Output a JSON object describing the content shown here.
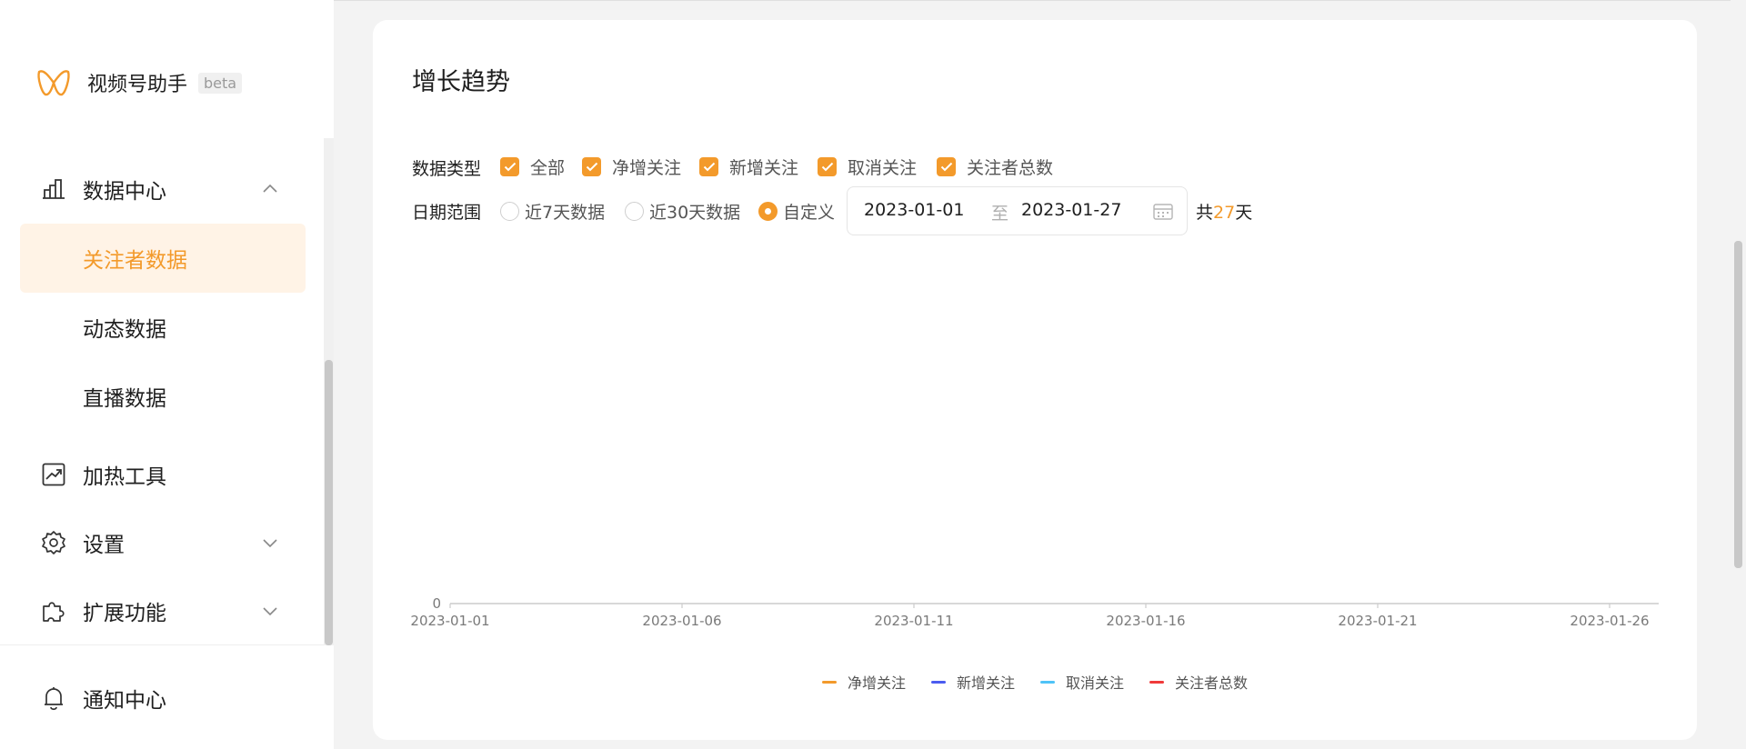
{
  "app": {
    "name": "视频号助手",
    "badge": "beta"
  },
  "sidebar": {
    "data_center": {
      "label": "数据中心",
      "items": [
        {
          "label": "关注者数据",
          "active": true
        },
        {
          "label": "动态数据",
          "active": false
        },
        {
          "label": "直播数据",
          "active": false
        }
      ]
    },
    "promo_tool": {
      "label": "加热工具"
    },
    "settings": {
      "label": "设置"
    },
    "extensions": {
      "label": "扩展功能"
    },
    "notifications": {
      "label": "通知中心"
    }
  },
  "card": {
    "title": "增长趋势"
  },
  "filters": {
    "data_type": {
      "label": "数据类型",
      "options": [
        {
          "label": "全部",
          "checked": true
        },
        {
          "label": "净增关注",
          "checked": true
        },
        {
          "label": "新增关注",
          "checked": true
        },
        {
          "label": "取消关注",
          "checked": true
        },
        {
          "label": "关注者总数",
          "checked": true
        }
      ]
    },
    "date_range": {
      "label": "日期范围",
      "options": [
        {
          "label": "近7天数据",
          "checked": false
        },
        {
          "label": "近30天数据",
          "checked": false
        },
        {
          "label": "自定义",
          "checked": true
        }
      ],
      "start": "2023-01-01",
      "separator": "至",
      "end": "2023-01-27",
      "total_prefix": "共",
      "total_days": "27",
      "total_suffix": "天"
    }
  },
  "colors": {
    "accent": "#f39a2b",
    "active_bg": "#fff3e6"
  },
  "chart_data": {
    "type": "line",
    "x": [
      "2023-01-01",
      "2023-01-06",
      "2023-01-11",
      "2023-01-16",
      "2023-01-21",
      "2023-01-26"
    ],
    "ytick": "0",
    "series": [
      {
        "name": "净增关注",
        "color": "#f39a2b",
        "values": [
          0,
          0,
          0,
          0,
          0,
          0
        ]
      },
      {
        "name": "新增关注",
        "color": "#4b5cf0",
        "values": [
          0,
          0,
          0,
          0,
          0,
          0
        ]
      },
      {
        "name": "取消关注",
        "color": "#4fc3f7",
        "values": [
          0,
          0,
          0,
          0,
          0,
          0
        ]
      },
      {
        "name": "关注者总数",
        "color": "#f03a3a",
        "values": [
          0,
          0,
          0,
          0,
          0,
          0
        ]
      }
    ],
    "legend_position": "bottom"
  }
}
